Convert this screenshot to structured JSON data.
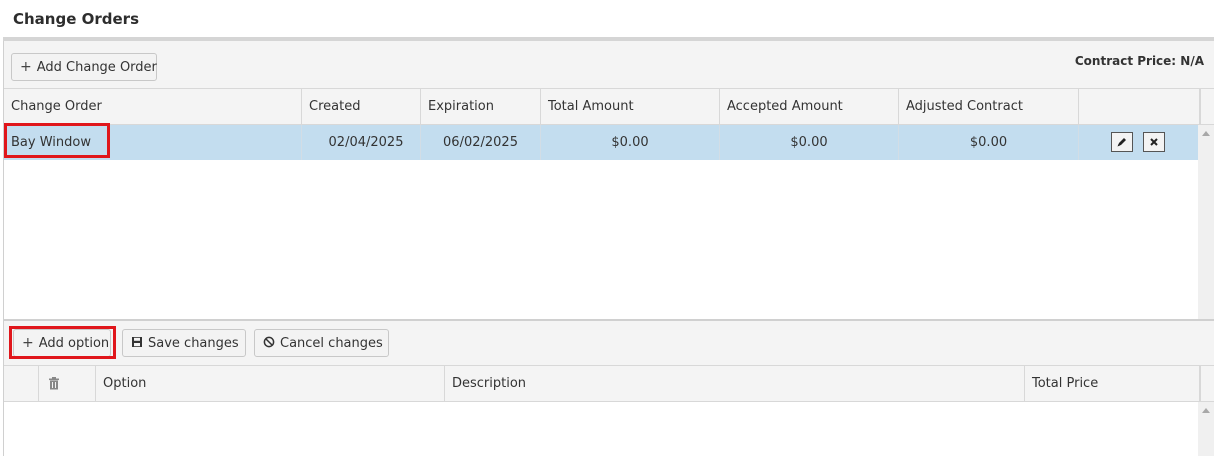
{
  "page": {
    "title": "Change Orders"
  },
  "toolbar": {
    "add_change_order": "Add Change Order",
    "contract_price": "Contract Price: N/A"
  },
  "change_orders_grid": {
    "columns": [
      "Change Order",
      "Created",
      "Expiration",
      "Total Amount",
      "Accepted Amount",
      "Adjusted Contract"
    ],
    "rows": [
      {
        "change_order": "Bay Window",
        "created": "02/04/2025",
        "expiration": "06/02/2025",
        "total_amount": "$0.00",
        "accepted_amount": "$0.00",
        "adjusted_contract": "$0.00",
        "actions": [
          "edit-icon",
          "delete-icon"
        ]
      }
    ]
  },
  "options_toolbar": {
    "add_option": "Add option",
    "save_changes": "Save changes",
    "cancel_changes": "Cancel changes"
  },
  "options_grid": {
    "columns": [
      "Option",
      "Description",
      "Total Price"
    ],
    "rows": []
  },
  "colors": {
    "selected_row": "#c3ddef",
    "highlight_border": "#e0161b",
    "header_bg": "#f4f4f4"
  }
}
